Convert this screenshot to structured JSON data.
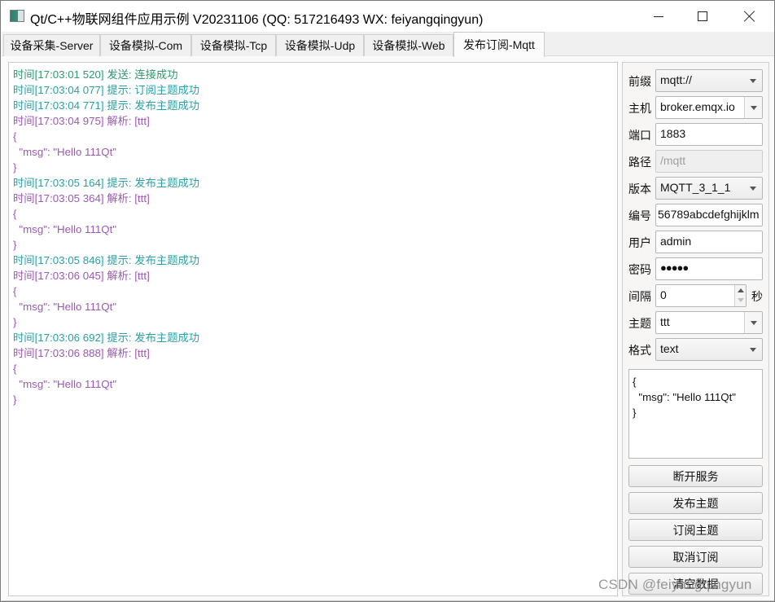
{
  "window": {
    "title": "Qt/C++物联网组件应用示例 V20231106 (QQ: 517216493 WX: feiyangqingyun)",
    "controls": {
      "minimize": "minimize-icon",
      "maximize": "maximize-icon",
      "close": "close-icon"
    }
  },
  "tabs": [
    {
      "label": "设备采集-Server",
      "active": false
    },
    {
      "label": "设备模拟-Com",
      "active": false
    },
    {
      "label": "设备模拟-Tcp",
      "active": false
    },
    {
      "label": "设备模拟-Udp",
      "active": false
    },
    {
      "label": "设备模拟-Web",
      "active": false
    },
    {
      "label": "发布订阅-Mqtt",
      "active": true
    }
  ],
  "log": {
    "colors": {
      "send": "#2e9a6f",
      "hint": "#2aa0a6",
      "parse": "#9b59b6"
    },
    "lines": [
      {
        "text": "时间[17:03:01 520] 发送: 连接成功",
        "type": "send"
      },
      {
        "text": "时间[17:03:04 077] 提示: 订阅主题成功",
        "type": "hint"
      },
      {
        "text": "时间[17:03:04 771] 提示: 发布主题成功",
        "type": "hint"
      },
      {
        "text": "时间[17:03:04 975] 解析: [ttt]",
        "type": "parse"
      },
      {
        "text": "{",
        "type": "parse"
      },
      {
        "text": "  \"msg\": \"Hello 111Qt\"",
        "type": "parse"
      },
      {
        "text": "}",
        "type": "parse"
      },
      {
        "text": "时间[17:03:05 164] 提示: 发布主题成功",
        "type": "hint"
      },
      {
        "text": "时间[17:03:05 364] 解析: [ttt]",
        "type": "parse"
      },
      {
        "text": "{",
        "type": "parse"
      },
      {
        "text": "  \"msg\": \"Hello 111Qt\"",
        "type": "parse"
      },
      {
        "text": "}",
        "type": "parse"
      },
      {
        "text": "时间[17:03:05 846] 提示: 发布主题成功",
        "type": "hint"
      },
      {
        "text": "时间[17:03:06 045] 解析: [ttt]",
        "type": "parse"
      },
      {
        "text": "{",
        "type": "parse"
      },
      {
        "text": "  \"msg\": \"Hello 111Qt\"",
        "type": "parse"
      },
      {
        "text": "}",
        "type": "parse"
      },
      {
        "text": "时间[17:03:06 692] 提示: 发布主题成功",
        "type": "hint"
      },
      {
        "text": "时间[17:03:06 888] 解析: [ttt]",
        "type": "parse"
      },
      {
        "text": "{",
        "type": "parse"
      },
      {
        "text": "  \"msg\": \"Hello 111Qt\"",
        "type": "parse"
      },
      {
        "text": "}",
        "type": "parse"
      }
    ]
  },
  "settings": {
    "prefix": {
      "label": "前缀",
      "value": "mqtt://"
    },
    "host": {
      "label": "主机",
      "value": "broker.emqx.io"
    },
    "port": {
      "label": "端口",
      "value": "1883"
    },
    "path": {
      "label": "路径",
      "placeholder": "/mqtt"
    },
    "version": {
      "label": "版本",
      "value": "MQTT_3_1_1"
    },
    "client_id": {
      "label": "编号",
      "value": "56789abcdefghijklm"
    },
    "user": {
      "label": "用户",
      "value": "admin"
    },
    "password": {
      "label": "密码",
      "value": "●●●●●"
    },
    "interval": {
      "label": "间隔",
      "value": "0",
      "unit": "秒"
    },
    "topic": {
      "label": "主题",
      "value": "ttt"
    },
    "format": {
      "label": "格式",
      "value": "text"
    },
    "payload": "{\n  \"msg\": \"Hello 111Qt\"\n}"
  },
  "buttons": {
    "disconnect": "断开服务",
    "publish": "发布主题",
    "subscribe": "订阅主题",
    "unsubscribe": "取消订阅",
    "clear": "清空数据"
  },
  "watermark": "CSDN @feiyangqingyun"
}
